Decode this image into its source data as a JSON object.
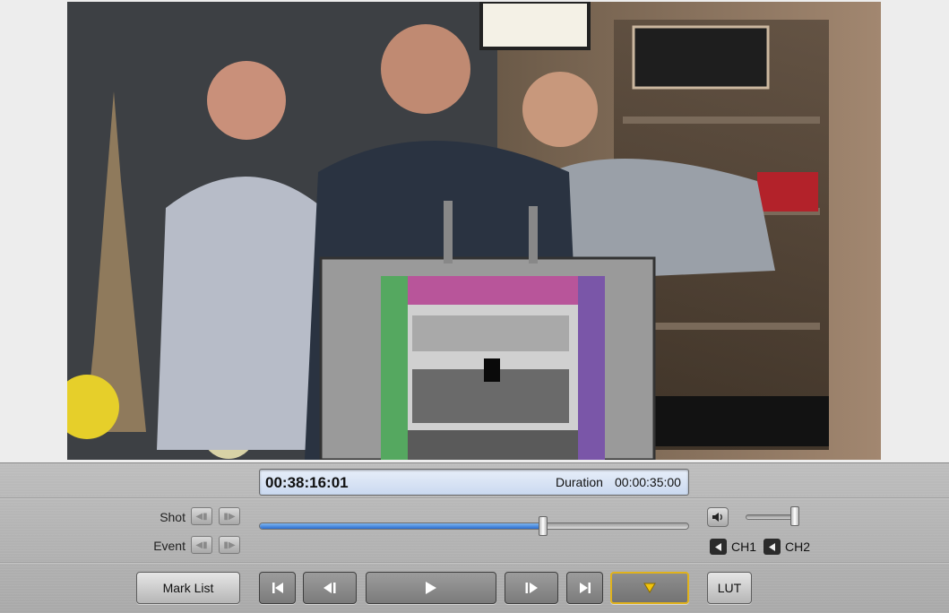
{
  "timecode": {
    "current": "00:38:16:01",
    "duration_label": "Duration",
    "duration_value": "00:00:35:00"
  },
  "navigation": {
    "shot_label": "Shot",
    "event_label": "Event"
  },
  "scrubber": {
    "progress_fraction": 0.66
  },
  "volume": {
    "level_fraction": 0.92
  },
  "channels": [
    {
      "label": "CH1"
    },
    {
      "label": "CH2"
    }
  ],
  "buttons": {
    "mark_list": "Mark List",
    "lut": "LUT"
  },
  "icons": {
    "go_to_start": "skip-to-start-icon",
    "step_back": "step-back-icon",
    "play": "play-icon",
    "step_forward": "step-forward-icon",
    "go_to_end": "skip-to-end-icon",
    "marker": "marker-triangle-icon",
    "volume": "speaker-icon"
  },
  "colors": {
    "progress": "#2c6fd0",
    "marker_border": "#e0b21c",
    "timecode_bg": "#d7e3f5"
  }
}
